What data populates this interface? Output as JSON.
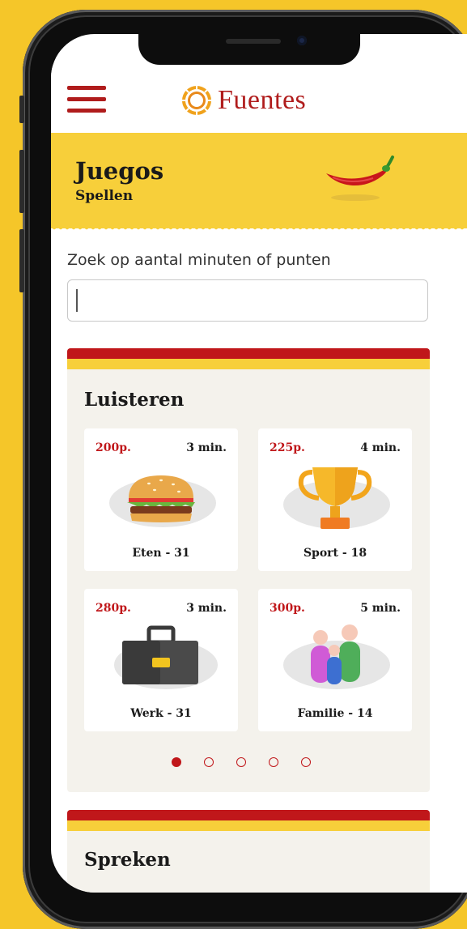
{
  "app": {
    "logo_text": "Fuentes"
  },
  "band": {
    "title": "Juegos",
    "subtitle": "Spellen"
  },
  "search": {
    "label": "Zoek op aantal minuten of punten",
    "value": "",
    "placeholder": ""
  },
  "sections": [
    {
      "title": "Luisteren",
      "tiles": [
        {
          "points": "200p.",
          "minutes": "3 min.",
          "caption": "Eten - 31",
          "icon": "burger-icon"
        },
        {
          "points": "225p.",
          "minutes": "4 min.",
          "caption": "Sport - 18",
          "icon": "trophy-icon"
        },
        {
          "points": "280p.",
          "minutes": "3 min.",
          "caption": "Werk - 31",
          "icon": "briefcase-icon"
        },
        {
          "points": "300p.",
          "minutes": "5 min.",
          "caption": "Familie - 14",
          "icon": "family-icon"
        }
      ],
      "pagination": {
        "total": 5,
        "active": 1
      }
    },
    {
      "title": "Spreken"
    }
  ],
  "colors": {
    "brand_red": "#c0171a",
    "brand_yellow": "#f7cf3a",
    "card_bg": "#f4f2ec"
  }
}
